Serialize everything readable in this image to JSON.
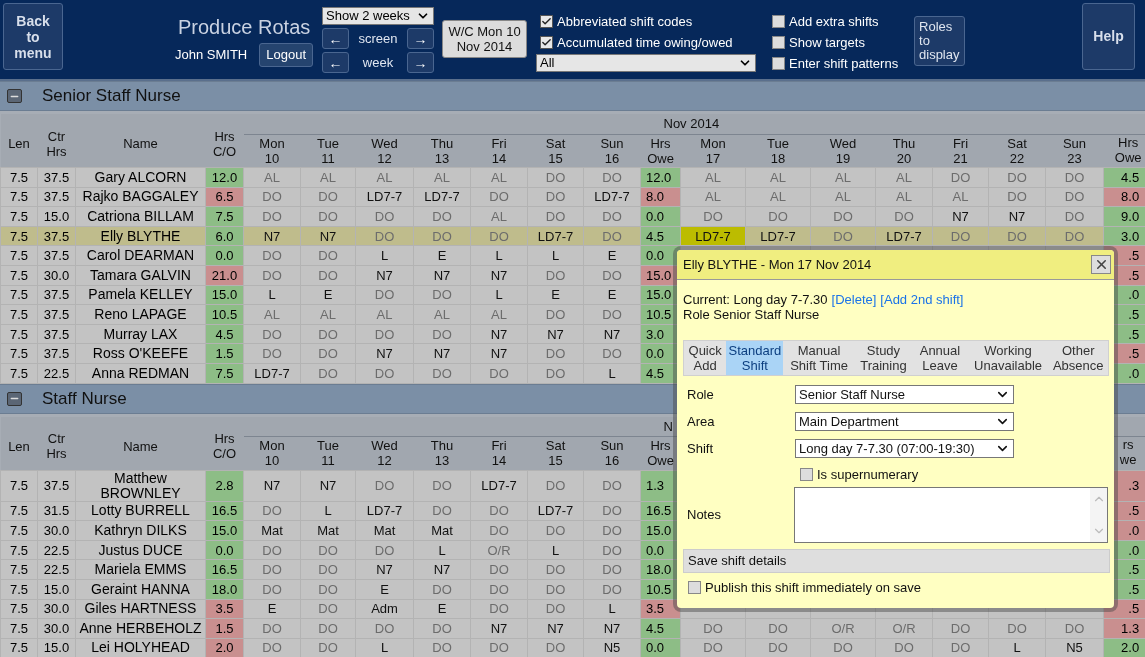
{
  "header": {
    "back_button": "Back to menu",
    "title": "Produce Rotas",
    "user": "John SMITH",
    "logout_button": "Logout",
    "weeks_select": "Show 2 weeks",
    "nav": [
      {
        "prev": "←",
        "label": "screen",
        "next": "→"
      },
      {
        "prev": "←",
        "label": "week",
        "next": "→"
      }
    ],
    "week_button": "W/C Mon 10 Nov 2014",
    "options_left": [
      {
        "label": "Abbreviated shift codes",
        "checked": true
      },
      {
        "label": "Accumulated time owing/owed",
        "checked": true
      }
    ],
    "filter_select": "All",
    "options_right": [
      {
        "label": "Add extra shifts",
        "checked": false
      },
      {
        "label": "Show targets",
        "checked": false
      },
      {
        "label": "Enter shift patterns",
        "checked": false
      }
    ],
    "roles_button": "Roles to display",
    "help_button": "Help"
  },
  "sections": [
    {
      "title": "Senior Staff Nurse",
      "expanded": true,
      "month": "Nov 2014",
      "columns": [
        "Len",
        "Ctr Hrs",
        "Name",
        "Hrs C/O"
      ],
      "week1_days": [
        {
          "day": "Mon",
          "date": "10"
        },
        {
          "day": "Tue",
          "date": "11"
        },
        {
          "day": "Wed",
          "date": "12"
        },
        {
          "day": "Thu",
          "date": "13"
        },
        {
          "day": "Fri",
          "date": "14"
        },
        {
          "day": "Sat",
          "date": "15"
        },
        {
          "day": "Sun",
          "date": "16"
        }
      ],
      "owe1_label": "Hrs Owe",
      "week2_days": [
        {
          "day": "Mon",
          "date": "17"
        },
        {
          "day": "Tue",
          "date": "18"
        },
        {
          "day": "Wed",
          "date": "19"
        },
        {
          "day": "Thu",
          "date": "20"
        },
        {
          "day": "Fri",
          "date": "21"
        },
        {
          "day": "Sat",
          "date": "22"
        },
        {
          "day": "Sun",
          "date": "23"
        }
      ],
      "owe2_label": "Hrs Owe",
      "rows": [
        {
          "len": "7.5",
          "ctr": "37.5",
          "name": "Gary ALCORN",
          "co": "12.0",
          "co_ok": true,
          "selected": false,
          "week1": [
            {
              "code": "AL",
              "dim": true
            },
            {
              "code": "AL",
              "dim": true
            },
            {
              "code": "AL",
              "dim": true
            },
            {
              "code": "AL",
              "dim": true
            },
            {
              "code": "AL",
              "dim": true
            },
            {
              "code": "DO",
              "dim": true
            },
            {
              "code": "DO",
              "dim": true
            }
          ],
          "owe1": "12.0",
          "owe1_ok": true,
          "week2": [
            {
              "code": "AL",
              "dim": true,
              "selected": false
            },
            {
              "code": "AL",
              "dim": true,
              "selected": false
            },
            {
              "code": "AL",
              "dim": true,
              "selected": false
            },
            {
              "code": "AL",
              "dim": true,
              "selected": false
            },
            {
              "code": "DO",
              "dim": true,
              "selected": false
            },
            {
              "code": "DO",
              "dim": true,
              "selected": false
            },
            {
              "code": "DO",
              "dim": true,
              "selected": false
            }
          ],
          "owe2": "4.5",
          "owe2_ok": true
        },
        {
          "len": "7.5",
          "ctr": "37.5",
          "name": "Rajko BAGGALEY",
          "co": "6.5",
          "co_ok": false,
          "selected": false,
          "week1": [
            {
              "code": "DO",
              "dim": true
            },
            {
              "code": "DO",
              "dim": true
            },
            {
              "code": "LD7-7",
              "dim": false
            },
            {
              "code": "LD7-7",
              "dim": false
            },
            {
              "code": "DO",
              "dim": true
            },
            {
              "code": "DO",
              "dim": true
            },
            {
              "code": "LD7-7",
              "dim": false
            }
          ],
          "owe1": "8.0",
          "owe1_ok": false,
          "week2": [
            {
              "code": "AL",
              "dim": true,
              "selected": false
            },
            {
              "code": "AL",
              "dim": true,
              "selected": false
            },
            {
              "code": "AL",
              "dim": true,
              "selected": false
            },
            {
              "code": "AL",
              "dim": true,
              "selected": false
            },
            {
              "code": "AL",
              "dim": true,
              "selected": false
            },
            {
              "code": "DO",
              "dim": true,
              "selected": false
            },
            {
              "code": "DO",
              "dim": true,
              "selected": false
            }
          ],
          "owe2": "8.0",
          "owe2_ok": false
        },
        {
          "len": "7.5",
          "ctr": "15.0",
          "name": "Catriona BILLAM",
          "co": "7.5",
          "co_ok": true,
          "selected": false,
          "week1": [
            {
              "code": "DO",
              "dim": true
            },
            {
              "code": "DO",
              "dim": true
            },
            {
              "code": "DO",
              "dim": true
            },
            {
              "code": "DO",
              "dim": true
            },
            {
              "code": "AL",
              "dim": true
            },
            {
              "code": "DO",
              "dim": true
            },
            {
              "code": "DO",
              "dim": true
            }
          ],
          "owe1": "0.0",
          "owe1_ok": true,
          "week2": [
            {
              "code": "DO",
              "dim": true,
              "selected": false
            },
            {
              "code": "DO",
              "dim": true,
              "selected": false
            },
            {
              "code": "DO",
              "dim": true,
              "selected": false
            },
            {
              "code": "DO",
              "dim": true,
              "selected": false
            },
            {
              "code": "N7",
              "dim": false,
              "selected": false
            },
            {
              "code": "N7",
              "dim": false,
              "selected": false
            },
            {
              "code": "DO",
              "dim": true,
              "selected": false
            }
          ],
          "owe2": "9.0",
          "owe2_ok": true
        },
        {
          "len": "7.5",
          "ctr": "37.5",
          "name": "Elly BLYTHE",
          "co": "6.0",
          "co_ok": true,
          "selected": true,
          "week1": [
            {
              "code": "N7",
              "dim": false
            },
            {
              "code": "N7",
              "dim": false
            },
            {
              "code": "DO",
              "dim": true
            },
            {
              "code": "DO",
              "dim": true
            },
            {
              "code": "DO",
              "dim": true
            },
            {
              "code": "LD7-7",
              "dim": false
            },
            {
              "code": "DO",
              "dim": true
            }
          ],
          "owe1": "4.5",
          "owe1_ok": true,
          "week2": [
            {
              "code": "LD7-7",
              "dim": false,
              "selected": true
            },
            {
              "code": "LD7-7",
              "dim": false,
              "selected": false
            },
            {
              "code": "DO",
              "dim": true,
              "selected": false
            },
            {
              "code": "LD7-7",
              "dim": false,
              "selected": false
            },
            {
              "code": "DO",
              "dim": true,
              "selected": false
            },
            {
              "code": "DO",
              "dim": true,
              "selected": false
            },
            {
              "code": "DO",
              "dim": true,
              "selected": false
            }
          ],
          "owe2": "3.0",
          "owe2_ok": true
        },
        {
          "len": "7.5",
          "ctr": "37.5",
          "name": "Carol DEARMAN",
          "co": "0.0",
          "co_ok": true,
          "selected": false,
          "week1": [
            {
              "code": "DO",
              "dim": true
            },
            {
              "code": "DO",
              "dim": true
            },
            {
              "code": "L",
              "dim": false
            },
            {
              "code": "E",
              "dim": false
            },
            {
              "code": "L",
              "dim": false
            },
            {
              "code": "L",
              "dim": false
            },
            {
              "code": "E",
              "dim": false
            }
          ],
          "owe1": "0.0",
          "owe1_ok": true,
          "owe2": ".5",
          "owe2_ok": false
        },
        {
          "len": "7.5",
          "ctr": "30.0",
          "name": "Tamara GALVIN",
          "co": "21.0",
          "co_ok": false,
          "selected": false,
          "week1": [
            {
              "code": "DO",
              "dim": true
            },
            {
              "code": "DO",
              "dim": true
            },
            {
              "code": "N7",
              "dim": false
            },
            {
              "code": "N7",
              "dim": false
            },
            {
              "code": "N7",
              "dim": false
            },
            {
              "code": "DO",
              "dim": true
            },
            {
              "code": "DO",
              "dim": true
            }
          ],
          "owe1": "15.0",
          "owe1_ok": false,
          "owe2": ".5",
          "owe2_ok": false
        },
        {
          "len": "7.5",
          "ctr": "37.5",
          "name": "Pamela KELLEY",
          "co": "15.0",
          "co_ok": true,
          "selected": false,
          "week1": [
            {
              "code": "L",
              "dim": false
            },
            {
              "code": "E",
              "dim": false
            },
            {
              "code": "DO",
              "dim": true
            },
            {
              "code": "DO",
              "dim": true
            },
            {
              "code": "L",
              "dim": false
            },
            {
              "code": "E",
              "dim": false
            },
            {
              "code": "E",
              "dim": false
            }
          ],
          "owe1": "15.0",
          "owe1_ok": true,
          "owe2": ".0",
          "owe2_ok": true
        },
        {
          "len": "7.5",
          "ctr": "37.5",
          "name": "Reno LAPAGE",
          "co": "10.5",
          "co_ok": true,
          "selected": false,
          "week1": [
            {
              "code": "AL",
              "dim": true
            },
            {
              "code": "AL",
              "dim": true
            },
            {
              "code": "AL",
              "dim": true
            },
            {
              "code": "AL",
              "dim": true
            },
            {
              "code": "AL",
              "dim": true
            },
            {
              "code": "DO",
              "dim": true
            },
            {
              "code": "DO",
              "dim": true
            }
          ],
          "owe1": "10.5",
          "owe1_ok": true,
          "owe2": ".5",
          "owe2_ok": true
        },
        {
          "len": "7.5",
          "ctr": "37.5",
          "name": "Murray LAX",
          "co": "4.5",
          "co_ok": true,
          "selected": false,
          "week1": [
            {
              "code": "DO",
              "dim": true
            },
            {
              "code": "DO",
              "dim": true
            },
            {
              "code": "DO",
              "dim": true
            },
            {
              "code": "DO",
              "dim": true
            },
            {
              "code": "N7",
              "dim": false
            },
            {
              "code": "N7",
              "dim": false
            },
            {
              "code": "N7",
              "dim": false
            }
          ],
          "owe1": "3.0",
          "owe1_ok": true,
          "owe2": ".5",
          "owe2_ok": true
        },
        {
          "len": "7.5",
          "ctr": "37.5",
          "name": "Ross O'KEEFE",
          "co": "1.5",
          "co_ok": true,
          "selected": false,
          "week1": [
            {
              "code": "DO",
              "dim": true
            },
            {
              "code": "DO",
              "dim": true
            },
            {
              "code": "N7",
              "dim": false
            },
            {
              "code": "N7",
              "dim": false
            },
            {
              "code": "N7",
              "dim": false
            },
            {
              "code": "DO",
              "dim": true
            },
            {
              "code": "DO",
              "dim": true
            }
          ],
          "owe1": "0.0",
          "owe1_ok": true,
          "owe2": ".5",
          "owe2_ok": false
        },
        {
          "len": "7.5",
          "ctr": "22.5",
          "name": "Anna REDMAN",
          "co": "7.5",
          "co_ok": true,
          "selected": false,
          "week1": [
            {
              "code": "LD7-7",
              "dim": false
            },
            {
              "code": "DO",
              "dim": true
            },
            {
              "code": "DO",
              "dim": true
            },
            {
              "code": "DO",
              "dim": true
            },
            {
              "code": "DO",
              "dim": true
            },
            {
              "code": "DO",
              "dim": true
            },
            {
              "code": "L",
              "dim": false
            }
          ],
          "owe1": "4.5",
          "owe1_ok": true,
          "owe2": ".0",
          "owe2_ok": true
        }
      ]
    },
    {
      "title": "Staff Nurse",
      "expanded": true,
      "month": "N",
      "columns": [
        "Len",
        "Ctr Hrs",
        "Name",
        "Hrs C/O"
      ],
      "week1_days": [
        {
          "day": "Mon",
          "date": "10"
        },
        {
          "day": "Tue",
          "date": "11"
        },
        {
          "day": "Wed",
          "date": "12"
        },
        {
          "day": "Thu",
          "date": "13"
        },
        {
          "day": "Fri",
          "date": "14"
        },
        {
          "day": "Sat",
          "date": "15"
        },
        {
          "day": "Sun",
          "date": "16"
        }
      ],
      "owe1_label": "Hrs Owe",
      "owe2_label": "rs we",
      "rows": [
        {
          "len": "7.5",
          "ctr": "37.5",
          "name": "Matthew BROWNLEY",
          "co": "2.8",
          "co_ok": true,
          "selected": false,
          "week1": [
            {
              "code": "N7",
              "dim": false
            },
            {
              "code": "N7",
              "dim": false
            },
            {
              "code": "DO",
              "dim": true
            },
            {
              "code": "DO",
              "dim": true
            },
            {
              "code": "LD7-7",
              "dim": false
            },
            {
              "code": "DO",
              "dim": true
            },
            {
              "code": "DO",
              "dim": true
            }
          ],
          "owe1": "1.3",
          "owe1_ok": true,
          "owe2": ".3",
          "owe2_ok": false
        },
        {
          "len": "7.5",
          "ctr": "31.5",
          "name": "Lotty BURRELL",
          "co": "16.5",
          "co_ok": true,
          "selected": false,
          "week1": [
            {
              "code": "DO",
              "dim": true
            },
            {
              "code": "L",
              "dim": false
            },
            {
              "code": "LD7-7",
              "dim": false
            },
            {
              "code": "DO",
              "dim": true
            },
            {
              "code": "DO",
              "dim": true
            },
            {
              "code": "LD7-7",
              "dim": false
            },
            {
              "code": "DO",
              "dim": true
            }
          ],
          "owe1": "16.5",
          "owe1_ok": true,
          "owe2": ".5",
          "owe2_ok": false
        },
        {
          "len": "7.5",
          "ctr": "30.0",
          "name": "Kathryn DILKS",
          "co": "15.0",
          "co_ok": true,
          "selected": false,
          "week1": [
            {
              "code": "Mat",
              "dim": false
            },
            {
              "code": "Mat",
              "dim": false
            },
            {
              "code": "Mat",
              "dim": false
            },
            {
              "code": "Mat",
              "dim": false
            },
            {
              "code": "DO",
              "dim": true
            },
            {
              "code": "DO",
              "dim": true
            },
            {
              "code": "DO",
              "dim": true
            }
          ],
          "owe1": "15.0",
          "owe1_ok": true,
          "owe2": ".0",
          "owe2_ok": false
        },
        {
          "len": "7.5",
          "ctr": "22.5",
          "name": "Justus DUCE",
          "co": "0.0",
          "co_ok": true,
          "selected": false,
          "week1": [
            {
              "code": "DO",
              "dim": true
            },
            {
              "code": "DO",
              "dim": true
            },
            {
              "code": "DO",
              "dim": true
            },
            {
              "code": "L",
              "dim": false
            },
            {
              "code": "O/R",
              "dim": true
            },
            {
              "code": "L",
              "dim": false
            },
            {
              "code": "DO",
              "dim": true
            }
          ],
          "owe1": "0.0",
          "owe1_ok": true,
          "owe2": ".0",
          "owe2_ok": true
        },
        {
          "len": "7.5",
          "ctr": "22.5",
          "name": "Mariela EMMS",
          "co": "16.5",
          "co_ok": true,
          "selected": false,
          "week1": [
            {
              "code": "DO",
              "dim": true
            },
            {
              "code": "DO",
              "dim": true
            },
            {
              "code": "N7",
              "dim": false
            },
            {
              "code": "N7",
              "dim": false
            },
            {
              "code": "DO",
              "dim": true
            },
            {
              "code": "DO",
              "dim": true
            },
            {
              "code": "DO",
              "dim": true
            }
          ],
          "owe1": "18.0",
          "owe1_ok": true,
          "owe2": ".5",
          "owe2_ok": true
        },
        {
          "len": "7.5",
          "ctr": "15.0",
          "name": "Geraint HANNA",
          "co": "18.0",
          "co_ok": true,
          "selected": false,
          "week1": [
            {
              "code": "DO",
              "dim": true
            },
            {
              "code": "DO",
              "dim": true
            },
            {
              "code": "E",
              "dim": false
            },
            {
              "code": "DO",
              "dim": true
            },
            {
              "code": "DO",
              "dim": true
            },
            {
              "code": "DO",
              "dim": true
            },
            {
              "code": "DO",
              "dim": true
            }
          ],
          "owe1": "10.5",
          "owe1_ok": true,
          "owe2": ".5",
          "owe2_ok": true
        },
        {
          "len": "7.5",
          "ctr": "30.0",
          "name": "Giles HARTNESS",
          "co": "3.5",
          "co_ok": false,
          "selected": false,
          "week1": [
            {
              "code": "E",
              "dim": false
            },
            {
              "code": "DO",
              "dim": true
            },
            {
              "code": "Adm",
              "dim": false
            },
            {
              "code": "E",
              "dim": false
            },
            {
              "code": "DO",
              "dim": true
            },
            {
              "code": "DO",
              "dim": true
            },
            {
              "code": "L",
              "dim": false
            }
          ],
          "owe1": "3.5",
          "owe1_ok": false,
          "owe2": ".5",
          "owe2_ok": false
        },
        {
          "len": "7.5",
          "ctr": "30.0",
          "name": "Anne HERBEHOLZ",
          "co": "1.5",
          "co_ok": false,
          "selected": false,
          "week1": [
            {
              "code": "DO",
              "dim": true
            },
            {
              "code": "DO",
              "dim": true
            },
            {
              "code": "DO",
              "dim": true
            },
            {
              "code": "DO",
              "dim": true
            },
            {
              "code": "N7",
              "dim": false
            },
            {
              "code": "N7",
              "dim": false
            },
            {
              "code": "N7",
              "dim": false
            }
          ],
          "owe1": "4.5",
          "owe1_ok": true,
          "week2": [
            {
              "code": "DO",
              "dim": true,
              "selected": false
            },
            {
              "code": "DO",
              "dim": true,
              "selected": false
            },
            {
              "code": "O/R",
              "dim": true,
              "selected": false
            },
            {
              "code": "O/R",
              "dim": true,
              "selected": false
            },
            {
              "code": "DO",
              "dim": true,
              "selected": false
            },
            {
              "code": "DO",
              "dim": true,
              "selected": false
            },
            {
              "code": "DO",
              "dim": true,
              "selected": false
            }
          ],
          "owe2": "1.3",
          "owe2_ok": false
        },
        {
          "len": "7.5",
          "ctr": "15.0",
          "name": "Lei HOLYHEAD",
          "co": "2.0",
          "co_ok": false,
          "selected": false,
          "week1": [
            {
              "code": "DO",
              "dim": true
            },
            {
              "code": "DO",
              "dim": true
            },
            {
              "code": "L",
              "dim": false
            },
            {
              "code": "DO",
              "dim": true
            },
            {
              "code": "DO",
              "dim": true
            },
            {
              "code": "DO",
              "dim": true
            },
            {
              "code": "N5",
              "dim": false
            }
          ],
          "owe1": "0.0",
          "owe1_ok": true,
          "week2": [
            {
              "code": "DO",
              "dim": true,
              "selected": false
            },
            {
              "code": "DO",
              "dim": true,
              "selected": false
            },
            {
              "code": "DO",
              "dim": true,
              "selected": false
            },
            {
              "code": "DO",
              "dim": true,
              "selected": false
            },
            {
              "code": "DO",
              "dim": true,
              "selected": false
            },
            {
              "code": "L",
              "dim": false,
              "selected": false
            },
            {
              "code": "N5",
              "dim": false,
              "selected": false
            }
          ],
          "owe2": "2.0",
          "owe2_ok": true
        }
      ]
    }
  ],
  "dialog": {
    "title": "Elly BLYTHE - Mon 17 Nov 2014",
    "current": "Current: Long day 7-7.30",
    "links": [
      "[Delete]",
      "[Add 2nd shift]"
    ],
    "role_line": "Role Senior Staff Nurse",
    "tabs": [
      {
        "label": "Quick Add",
        "selected": false
      },
      {
        "label": "Standard Shift",
        "selected": true
      },
      {
        "label": "Manual Shift Time",
        "selected": false
      },
      {
        "label": "Study Training",
        "selected": false
      },
      {
        "label": "Annual Leave",
        "selected": false
      },
      {
        "label": "Working Unavailable",
        "selected": false
      },
      {
        "label": "Other Absence",
        "selected": false
      }
    ],
    "fields": [
      {
        "label": "Role",
        "value": "Senior Staff Nurse"
      },
      {
        "label": "Area",
        "value": "Main Department"
      },
      {
        "label": "Shift",
        "value": "Long day 7-7.30 (07:00-19:30)"
      }
    ],
    "supernumerary": {
      "label": "Is supernumerary",
      "checked": false
    },
    "notes_label": "Notes",
    "save_button": "Save shift details",
    "publish": {
      "label": "Publish this shift immediately on save",
      "checked": false
    }
  }
}
